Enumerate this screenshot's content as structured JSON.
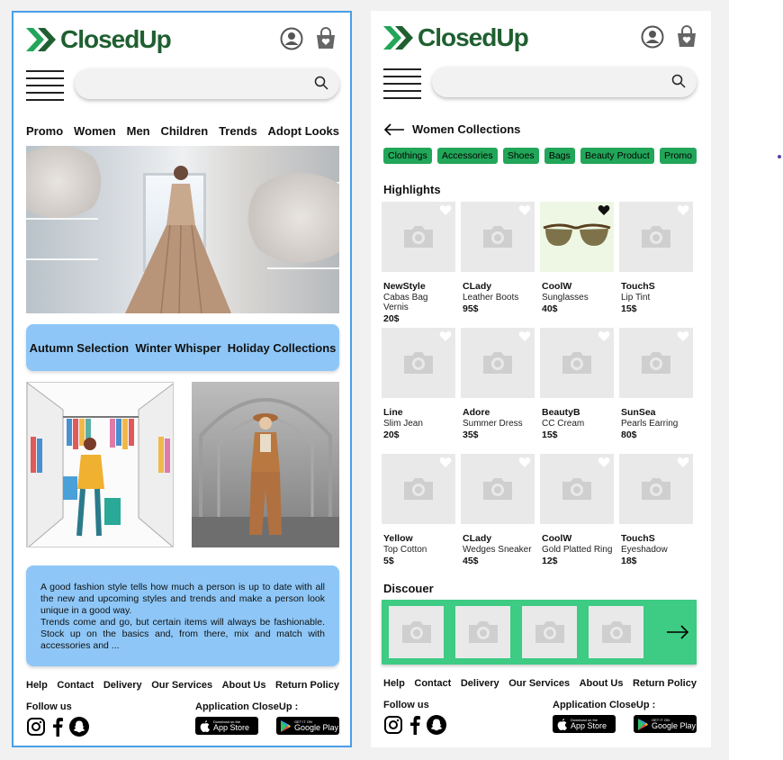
{
  "brand": {
    "name": "ClosedUp",
    "green": "#1f5f30",
    "accent": "#22a659"
  },
  "search": {
    "placeholder": ""
  },
  "left": {
    "nav": [
      "Promo",
      "Women",
      "Men",
      "Children",
      "Trends",
      "Adopt Looks"
    ],
    "banner": [
      "Autumn Selection",
      "Winter Whisper",
      "Holiday Collections"
    ],
    "paragraph1": "A good fashion style tells how much a person is up to date with all the new and upcoming styles and trends and make a person look unique in a good way.",
    "paragraph2": "Trends come and go, but certain items will always be fashionable. Stock up on the basics and, from there, mix and match with accessories and ..."
  },
  "right": {
    "back_title": "Women Collections",
    "chips": [
      "Clothings",
      "Accessories",
      "Shoes",
      "Bags",
      "Beauty Product",
      "Promo"
    ],
    "highlights_title": "Highlights",
    "products": [
      {
        "brand": "NewStyle",
        "name": "Cabas Bag Vernis",
        "price": "20$",
        "image": "placeholder",
        "liked": false
      },
      {
        "brand": "CLady",
        "name": "Leather Boots",
        "price": "95$",
        "image": "placeholder",
        "liked": false
      },
      {
        "brand": "CoolW",
        "name": "Sunglasses",
        "price": "40$",
        "image": "sunglasses",
        "liked": true
      },
      {
        "brand": "TouchS",
        "name": "Lip Tint",
        "price": "15$",
        "image": "placeholder",
        "liked": false
      },
      {
        "brand": "Line",
        "name": "Slim Jean",
        "price": "20$",
        "image": "placeholder",
        "liked": false
      },
      {
        "brand": "Adore",
        "name": "Summer Dress",
        "price": "35$",
        "image": "placeholder",
        "liked": false
      },
      {
        "brand": "BeautyB",
        "name": "CC Cream",
        "price": "15$",
        "image": "placeholder",
        "liked": false
      },
      {
        "brand": "SunSea",
        "name": "Pearls Earring",
        "price": "80$",
        "image": "placeholder",
        "liked": false
      },
      {
        "brand": "Yellow",
        "name": "Top Cotton",
        "price": "5$",
        "image": "placeholder",
        "liked": false
      },
      {
        "brand": "CLady",
        "name": "Wedges Sneaker",
        "price": "45$",
        "image": "placeholder",
        "liked": false
      },
      {
        "brand": "CoolW",
        "name": "Gold Platted Ring",
        "price": "12$",
        "image": "placeholder",
        "liked": false
      },
      {
        "brand": "TouchS",
        "name": "Eyeshadow",
        "price": "18$",
        "image": "placeholder",
        "liked": false
      }
    ],
    "discover_title": "Discouer"
  },
  "footer": {
    "links": [
      "Help",
      "Contact",
      "Delivery",
      "Our Services",
      "About Us",
      "Return Policy"
    ],
    "follow": "Follow us",
    "app_title": "Application CloseUp :",
    "app_store_small": "Download on the",
    "app_store": "App Store",
    "google_small": "GET IT ON",
    "google": "Google Play"
  }
}
